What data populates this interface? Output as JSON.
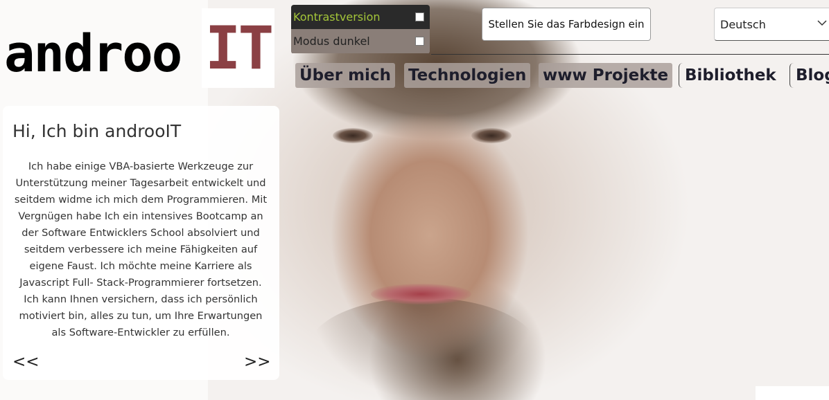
{
  "logo": {
    "text": "androo",
    "highlight": "IT",
    "highlight_color": "#8b4044"
  },
  "toggles": {
    "contrast_label": "Kontrastversion",
    "dark_label": "Modus dunkel",
    "contrast_color": "#a4c639"
  },
  "color_design_button": "Stellen Sie das Farbdesign ein",
  "language": {
    "selected": "Deutsch"
  },
  "nav": {
    "items": [
      {
        "label": "Über mich"
      },
      {
        "label": "Technologien"
      },
      {
        "label": "www Projekte"
      },
      {
        "label": "Bibliothek"
      },
      {
        "label": "Blog"
      }
    ]
  },
  "intro": {
    "title": "Hi, Ich bin androoIT",
    "text": "Ich habe einige VBA-basierte Werkzeuge zur Unterstützung meiner Tagesarbeit entwickelt und seitdem widme ich mich dem Programmieren. Mit Vergnügen habe Ich ein intensives Bootcamp an der Software Entwicklers School absolviert und seitdem verbessere ich meine Fähigkeiten auf eigene Faust. Ich möchte meine Karriere als Javascript Full- Stack-Programmierer fortsetzen. Ich kann Ihnen versichern, dass ich persönlich motiviert bin, alles zu tun, um Ihre Erwartungen als Software-Entwickler zu erfüllen.",
    "prev": "<<",
    "next": ">>"
  }
}
